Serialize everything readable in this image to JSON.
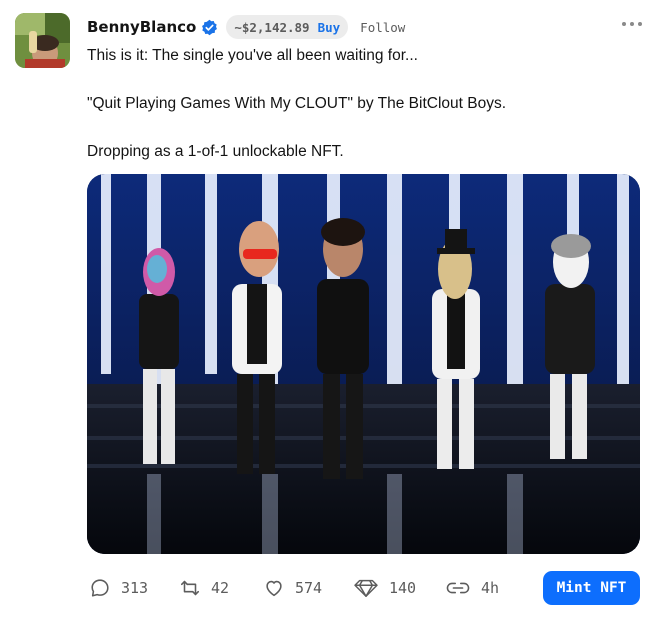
{
  "post": {
    "username": "BennyBlanco",
    "verified_icon": "verified-badge-icon",
    "price": "~$2,142.89",
    "buy_label": "Buy",
    "follow_label": "Follow",
    "more_icon": "more-horizontal-icon",
    "body_lines": [
      "This is it: The single you've all been waiting for...",
      "",
      "\"Quit Playing Games With My CLOUT\" by The BitClout Boys.",
      "",
      "Dropping as a 1-of-1 unlockable NFT."
    ]
  },
  "actions": {
    "comments": "313",
    "reposts": "42",
    "likes": "574",
    "diamonds": "140",
    "time": "4h",
    "mint_label": "Mint NFT"
  },
  "icons": {
    "comment": "comment-icon",
    "repost": "repost-icon",
    "like": "heart-icon",
    "diamond": "diamond-icon",
    "link": "link-icon"
  },
  "colors": {
    "accent": "#0d6efd",
    "verified": "#1a73e8",
    "pill_bg": "#ececec",
    "muted_text": "#5c5c5c"
  }
}
